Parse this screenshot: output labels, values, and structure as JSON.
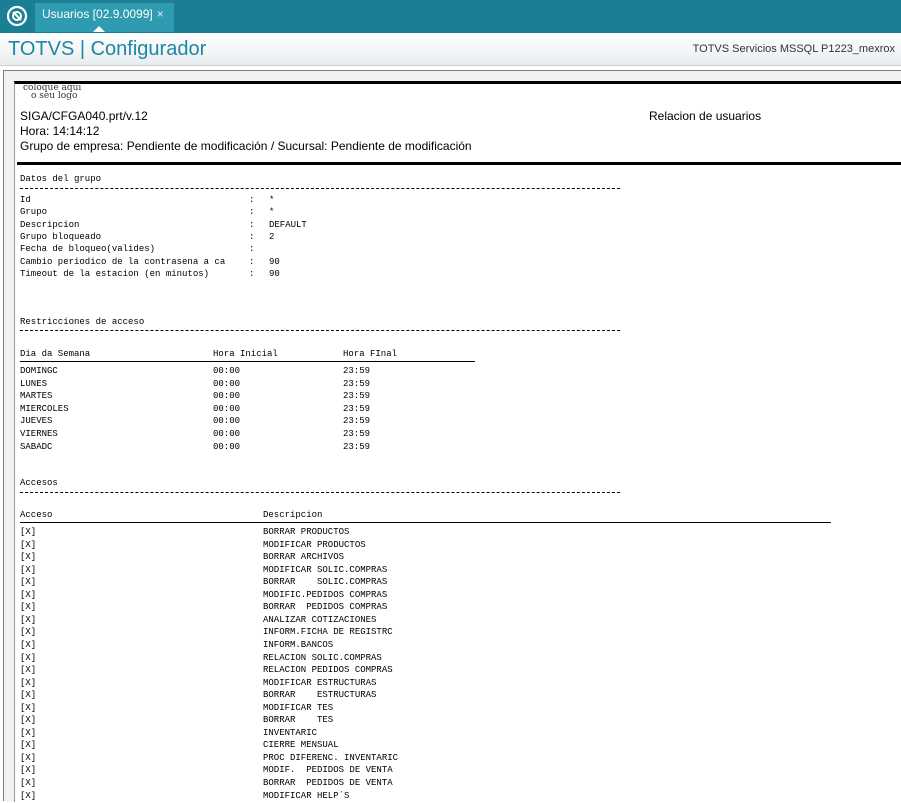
{
  "tab": {
    "label": "Usuarios [02.9.0099]",
    "close": "×"
  },
  "header": {
    "title": "TOTVS | Configurador",
    "server": "TOTVS Servicios MSSQL P1223_mexrox"
  },
  "report": {
    "logo": [
      "coloque aqui",
      "o seu logo"
    ],
    "program": "SIGA/CFGA040.prt/v.12",
    "time": "Hora: 14:14:12",
    "company": "Grupo de empresa: Pendiente de modificación / Sucursal: Pendiente de modificación",
    "title": "Relacion de usuarios",
    "group_section": {
      "title": "Datos del grupo",
      "fields": [
        {
          "label": "Id",
          "value": "*"
        },
        {
          "label": "Grupo",
          "value": "*"
        },
        {
          "label": "Descripcion",
          "value": "DEFAULT"
        },
        {
          "label": "Grupo bloqueado",
          "value": "2"
        },
        {
          "label": "Fecha de bloqueo(valides)",
          "value": ""
        },
        {
          "label": "Cambio periodico de la contrasena a ca",
          "value": "90"
        },
        {
          "label": "Timeout de la estacion (en minutos)",
          "value": "90"
        }
      ],
      "separator": ":"
    },
    "restrictions": {
      "title": "Restricciones de acceso",
      "headers": [
        "Dia da Semana",
        "Hora Inicial",
        "Hora FInal"
      ],
      "rows": [
        [
          "DOMINGC",
          "00:00",
          "23:59"
        ],
        [
          "LUNES",
          "00:00",
          "23:59"
        ],
        [
          "MARTES",
          "00:00",
          "23:59"
        ],
        [
          "MIERCOLES",
          "00:00",
          "23:59"
        ],
        [
          "JUEVES",
          "00:00",
          "23:59"
        ],
        [
          "VIERNES",
          "00:00",
          "23:59"
        ],
        [
          "SABADC",
          "00:00",
          "23:59"
        ]
      ]
    },
    "access": {
      "title": "Accesos",
      "headers": [
        "Acceso",
        "Descripcion"
      ],
      "rows": [
        [
          "[X]",
          "BORRAR PRODUCTOS"
        ],
        [
          "[X]",
          "MODIFICAR PRODUCTOS"
        ],
        [
          "[X]",
          "BORRAR ARCHIVOS"
        ],
        [
          "[X]",
          "MODIFICAR SOLIC.COMPRAS"
        ],
        [
          "[X]",
          "BORRAR    SOLIC.COMPRAS"
        ],
        [
          "[X]",
          "MODIFIC.PEDIDOS COMPRAS"
        ],
        [
          "[X]",
          "BORRAR  PEDIDOS COMPRAS"
        ],
        [
          "[X]",
          "ANALIZAR COTIZACIONES"
        ],
        [
          "[X]",
          "INFORM.FICHA DE REGISTRC"
        ],
        [
          "[X]",
          "INFORM.BANCOS"
        ],
        [
          "[X]",
          "RELACION SOLIC.COMPRAS"
        ],
        [
          "[X]",
          "RELACION PEDIDOS COMPRAS"
        ],
        [
          "[X]",
          "MODIFICAR ESTRUCTURAS"
        ],
        [
          "[X]",
          "BORRAR    ESTRUCTURAS"
        ],
        [
          "[X]",
          "MODIFICAR TES"
        ],
        [
          "[X]",
          "BORRAR    TES"
        ],
        [
          "[X]",
          "INVENTARIC"
        ],
        [
          "[X]",
          "CIERRE MENSUAL"
        ],
        [
          "[X]",
          "PROC DIFERENC. INVENTARIC"
        ],
        [
          "[X]",
          "MODIF.  PEDIDOS DE VENTA"
        ],
        [
          "[X]",
          "BORRAR  PEDIDOS DE VENTA"
        ],
        [
          "[X]",
          "MODIFICAR HELP´S"
        ]
      ]
    }
  }
}
